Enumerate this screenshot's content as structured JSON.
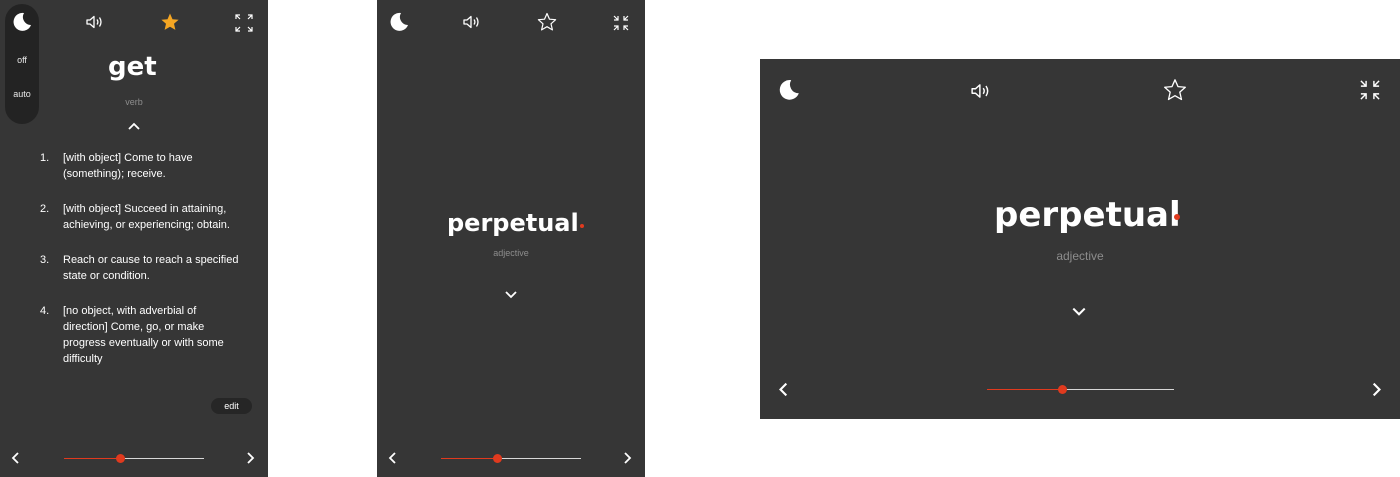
{
  "colors": {
    "panel_bg": "#363636",
    "accent": "#e03a1e",
    "star_active": "#f5a623",
    "text": "#ffffff",
    "muted": "#8d8d8d"
  },
  "screen1": {
    "word": "get",
    "part_of_speech": "verb",
    "night_mode_options": [
      "off",
      "auto"
    ],
    "favorite_active": true,
    "icons": [
      "moon-icon",
      "speaker-icon",
      "star-icon",
      "fullscreen-icon",
      "chevron-up-icon",
      "chevron-left-icon",
      "chevron-right-icon"
    ],
    "definitions": [
      {
        "number": "1.",
        "text": "[with object] Come to have (something); receive."
      },
      {
        "number": "2.",
        "text": "[with object] Succeed in attaining, achieving, or experiencing; obtain."
      },
      {
        "number": "3.",
        "text": "Reach or cause to reach a specified state or condition."
      },
      {
        "number": "4.",
        "text": "[no object, with adverbial of direction] Come, go, or make progress eventually or with some difficulty"
      }
    ],
    "edit_label": "edit",
    "progress": 0.4
  },
  "screen2": {
    "word": "perpetual",
    "part_of_speech": "adjective",
    "favorite_active": false,
    "icons": [
      "moon-icon",
      "speaker-icon",
      "star-icon",
      "collapse-icon",
      "chevron-down-icon",
      "chevron-left-icon",
      "chevron-right-icon"
    ],
    "progress": 0.4
  },
  "screen3": {
    "word": "perpetual",
    "part_of_speech": "adjective",
    "favorite_active": false,
    "icons": [
      "moon-icon",
      "speaker-icon",
      "star-icon",
      "collapse-icon",
      "chevron-down-icon",
      "chevron-left-icon",
      "chevron-right-icon"
    ],
    "progress": 0.4
  }
}
